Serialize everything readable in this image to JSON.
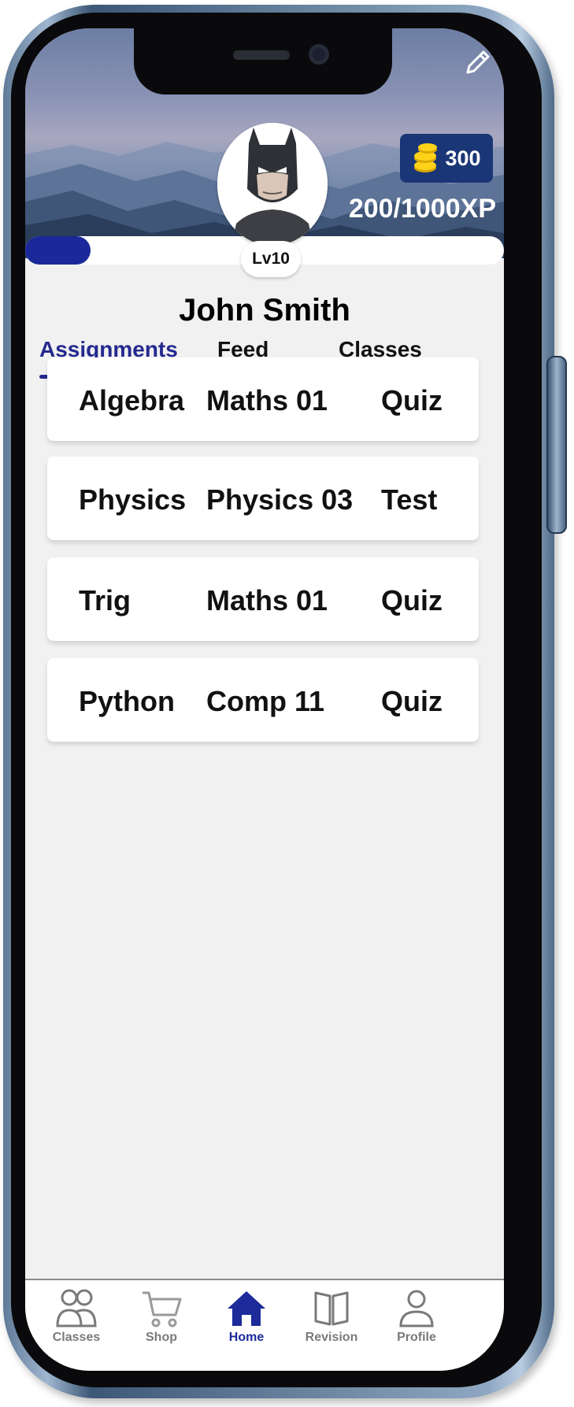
{
  "profile": {
    "name": "John Smith",
    "level": "Lv10",
    "coins": "300",
    "xp_text": "200/1000XP",
    "xp_progress_fraction": 0.2
  },
  "tabs": [
    {
      "label": "Assignments",
      "active": true
    },
    {
      "label": "Feed",
      "active": false
    },
    {
      "label": "Classes",
      "active": false
    }
  ],
  "assignments": [
    {
      "subject": "Algebra",
      "class": "Maths 01",
      "type": "Quiz"
    },
    {
      "subject": "Physics",
      "class": "Physics 03",
      "type": "Test"
    },
    {
      "subject": "Trig",
      "class": "Maths 01",
      "type": "Quiz"
    },
    {
      "subject": "Python",
      "class": "Comp 11",
      "type": "Quiz"
    }
  ],
  "nav": [
    {
      "label": "Classes",
      "icon": "people-icon",
      "active": false
    },
    {
      "label": "Shop",
      "icon": "cart-icon",
      "active": false
    },
    {
      "label": "Home",
      "icon": "home-icon",
      "active": true
    },
    {
      "label": "Revision",
      "icon": "book-icon",
      "active": false
    },
    {
      "label": "Profile",
      "icon": "person-icon",
      "active": false
    }
  ],
  "icons": {
    "edit": "pencil-icon",
    "coins": "coin-stack-icon",
    "avatar": "batman-avatar"
  },
  "colors": {
    "accent": "#1c2a9a",
    "coin_badge": "#1a3676",
    "progress_fill": "#1a2899",
    "screen_bg": "#f1f1f1"
  }
}
